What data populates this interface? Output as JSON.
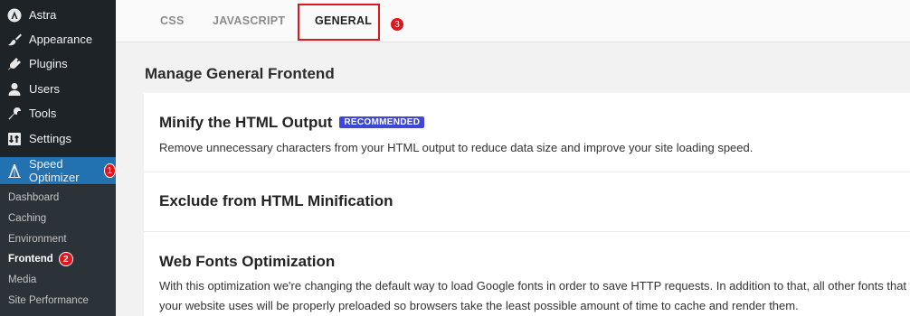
{
  "sidebar": {
    "items": [
      {
        "label": "Astra",
        "icon": "astra-icon"
      },
      {
        "label": "Appearance",
        "icon": "paintbrush-icon"
      },
      {
        "label": "Plugins",
        "icon": "plug-icon"
      },
      {
        "label": "Users",
        "icon": "user-icon"
      },
      {
        "label": "Tools",
        "icon": "wrench-icon"
      },
      {
        "label": "Settings",
        "icon": "settings-icon"
      }
    ],
    "active_item": {
      "label": "Speed Optimizer",
      "icon": "speed-optimizer-icon",
      "badge": "1"
    },
    "submenu": [
      {
        "label": "Dashboard"
      },
      {
        "label": "Caching"
      },
      {
        "label": "Environment"
      },
      {
        "label": "Frontend",
        "badge": "2"
      },
      {
        "label": "Media"
      },
      {
        "label": "Site Performance"
      }
    ]
  },
  "tabs": [
    {
      "label": "CSS"
    },
    {
      "label": "JAVASCRIPT"
    },
    {
      "label": "GENERAL",
      "badge": "3"
    }
  ],
  "main": {
    "section_title": "Manage General Frontend",
    "cards": [
      {
        "title": "Minify the HTML Output",
        "tag": "RECOMMENDED",
        "description": "Remove unnecessary characters from your HTML output to reduce data size and improve your site loading speed."
      },
      {
        "title": "Exclude from HTML Minification"
      },
      {
        "title": "Web Fonts Optimization",
        "description_line1": "With this optimization we're changing the default way to load Google fonts in order to save HTTP requests. In addition to that, all other fonts that",
        "description_line2": "your website uses will be properly preloaded so browsers take the least possible amount of time to cache and render them."
      }
    ]
  },
  "colors": {
    "sidebar_bg": "#1d2327",
    "active_blue": "#2271b1",
    "badge_red": "#e0161a",
    "tag_blue": "#3e47d6"
  }
}
